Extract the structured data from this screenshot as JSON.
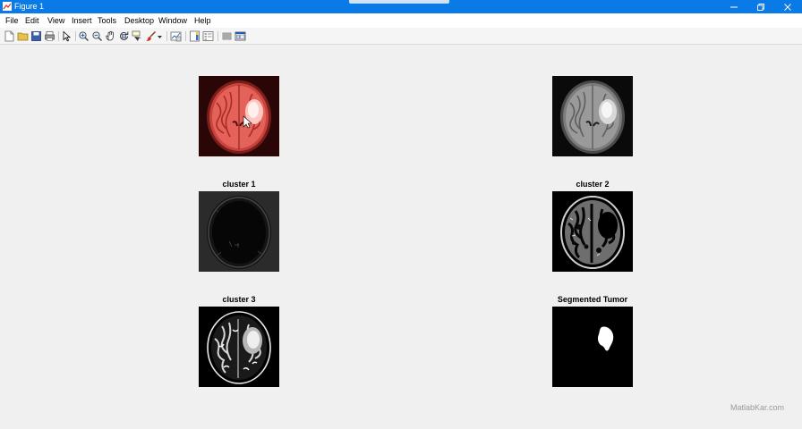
{
  "window": {
    "title": "Figure 1"
  },
  "menu": [
    "File",
    "Edit",
    "View",
    "Insert",
    "Tools",
    "Desktop",
    "Window",
    "Help"
  ],
  "toolbar_icons": [
    "new-figure-icon",
    "open-file-icon",
    "save-icon",
    "print-icon",
    "pointer-icon",
    "zoom-in-icon",
    "zoom-out-icon",
    "pan-icon",
    "rotate-3d-icon",
    "data-cursor-icon",
    "brush-icon",
    "brush-dropdown-icon",
    "link-plot-icon",
    "colorbar-icon",
    "legend-icon",
    "hide-plot-tools-icon",
    "show-plot-tools-icon"
  ],
  "panels": {
    "original": {
      "title": ""
    },
    "grayscale": {
      "title": ""
    },
    "cluster1": {
      "title": "cluster 1"
    },
    "cluster2": {
      "title": "cluster 2"
    },
    "cluster3": {
      "title": "cluster 3"
    },
    "tumor": {
      "title": "Segmented Tumor"
    }
  },
  "watermark": "MatlabKar.com",
  "colors": {
    "titlebar": "#0a7ae6",
    "figure_bg": "#f0f0f0",
    "mri_tint": "#e05a55"
  }
}
